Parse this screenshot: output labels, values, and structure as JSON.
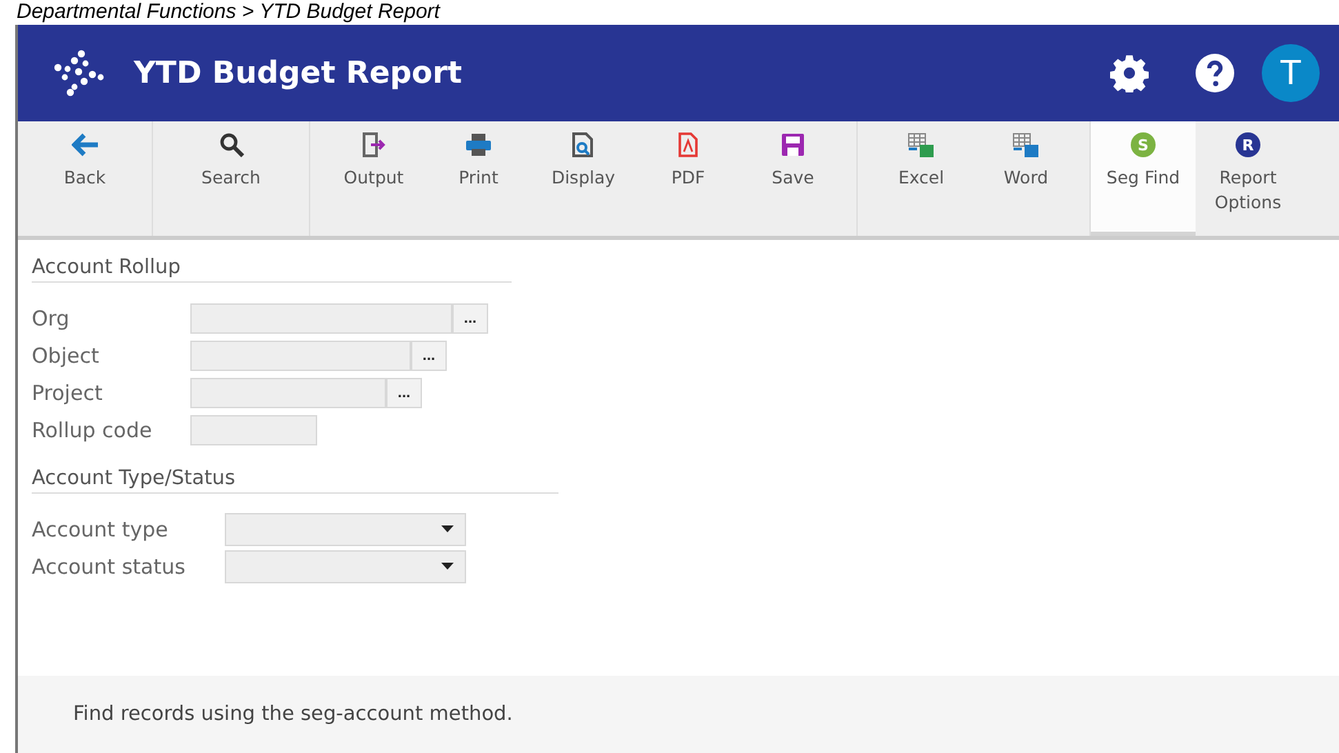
{
  "breadcrumb": "Departmental Functions > YTD Budget Report",
  "header": {
    "title": "YTD Budget Report",
    "avatar": "T"
  },
  "toolbar": {
    "groups": [
      [
        {
          "kind": "back",
          "label": "Back",
          "selected": false
        }
      ],
      [
        {
          "kind": "search",
          "label": "Search",
          "selected": false
        }
      ],
      [
        {
          "kind": "output",
          "label": "Output",
          "selected": false
        },
        {
          "kind": "print",
          "label": "Print",
          "selected": false
        },
        {
          "kind": "display",
          "label": "Display",
          "selected": false
        },
        {
          "kind": "pdf",
          "label": "PDF",
          "selected": false
        },
        {
          "kind": "save",
          "label": "Save",
          "selected": false
        }
      ],
      [
        {
          "kind": "excel",
          "label": "Excel",
          "selected": false
        },
        {
          "kind": "word",
          "label": "Word",
          "selected": false
        }
      ],
      [
        {
          "kind": "letter",
          "badge": "S",
          "color": "#7cb342",
          "label": "Seg Find",
          "selected": true
        },
        {
          "kind": "letter",
          "badge": "R",
          "color": "#283593",
          "label": "Report Options",
          "selected": false
        }
      ]
    ]
  },
  "sections": [
    {
      "title": "Account Rollup",
      "fields": [
        {
          "kind": "lookup",
          "label": "Org",
          "button": "..."
        },
        {
          "kind": "lookup",
          "label": "Object",
          "button": "..."
        },
        {
          "kind": "lookup",
          "label": "Project",
          "button": "..."
        },
        {
          "kind": "text",
          "label": "Rollup code"
        }
      ]
    },
    {
      "title": "Account Type/Status",
      "fields": [
        {
          "kind": "select",
          "label": "Account type"
        },
        {
          "kind": "select",
          "label": "Account status"
        }
      ]
    }
  ],
  "footer": {
    "text": "Find records using the seg-account method."
  }
}
